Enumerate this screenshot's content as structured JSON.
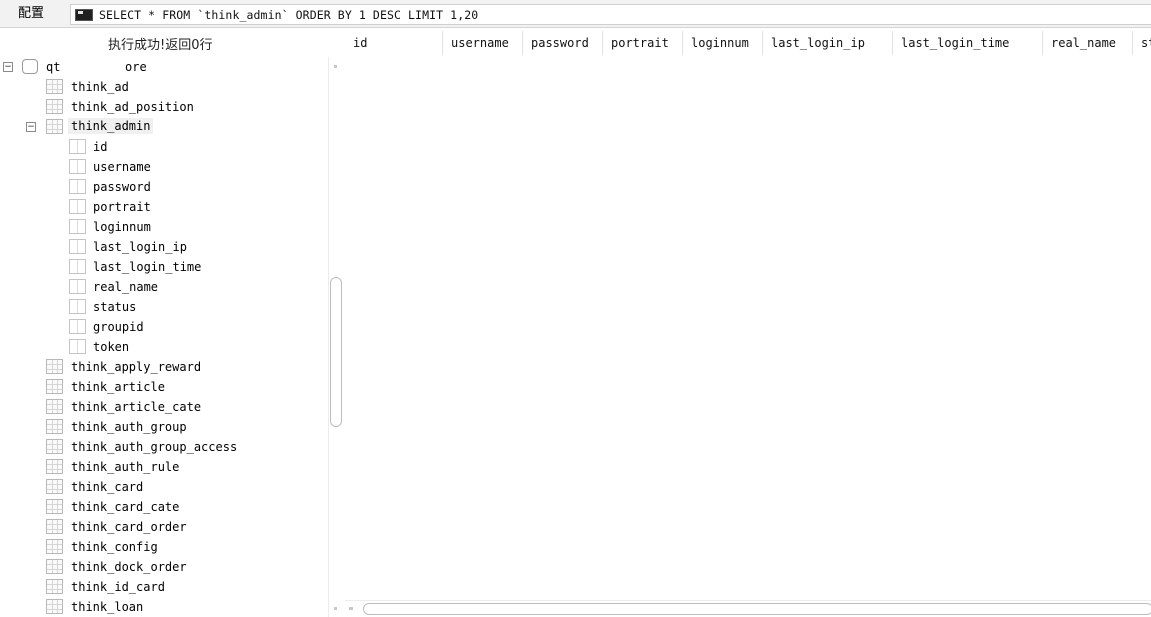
{
  "toolbar": {
    "config_label": "配置",
    "query": "SELECT * FROM `think_admin` ORDER BY 1 DESC LIMIT 1,20"
  },
  "status": "执行成功!返回0行",
  "grid": {
    "columns": [
      "id",
      "username",
      "password",
      "portrait",
      "loginnum",
      "last_login_ip",
      "last_login_time",
      "real_name",
      "st"
    ]
  },
  "tree": {
    "database": "qt",
    "database_suffix": "ore",
    "tables_before": [
      "think_ad",
      "think_ad_position"
    ],
    "expanded_table": "think_admin",
    "expanded_columns": [
      "id",
      "username",
      "password",
      "portrait",
      "loginnum",
      "last_login_ip",
      "last_login_time",
      "real_name",
      "status",
      "groupid",
      "token"
    ],
    "tables_after": [
      "think_apply_reward",
      "think_article",
      "think_article_cate",
      "think_auth_group",
      "think_auth_group_access",
      "think_auth_rule",
      "think_card",
      "think_card_cate",
      "think_card_order",
      "think_config",
      "think_dock_order",
      "think_id_card",
      "think_loan"
    ]
  },
  "icons": {
    "collapse": "minus-box-icon",
    "database": "database-icon",
    "table": "table-icon",
    "column": "column-icon",
    "terminal": "terminal-icon"
  }
}
